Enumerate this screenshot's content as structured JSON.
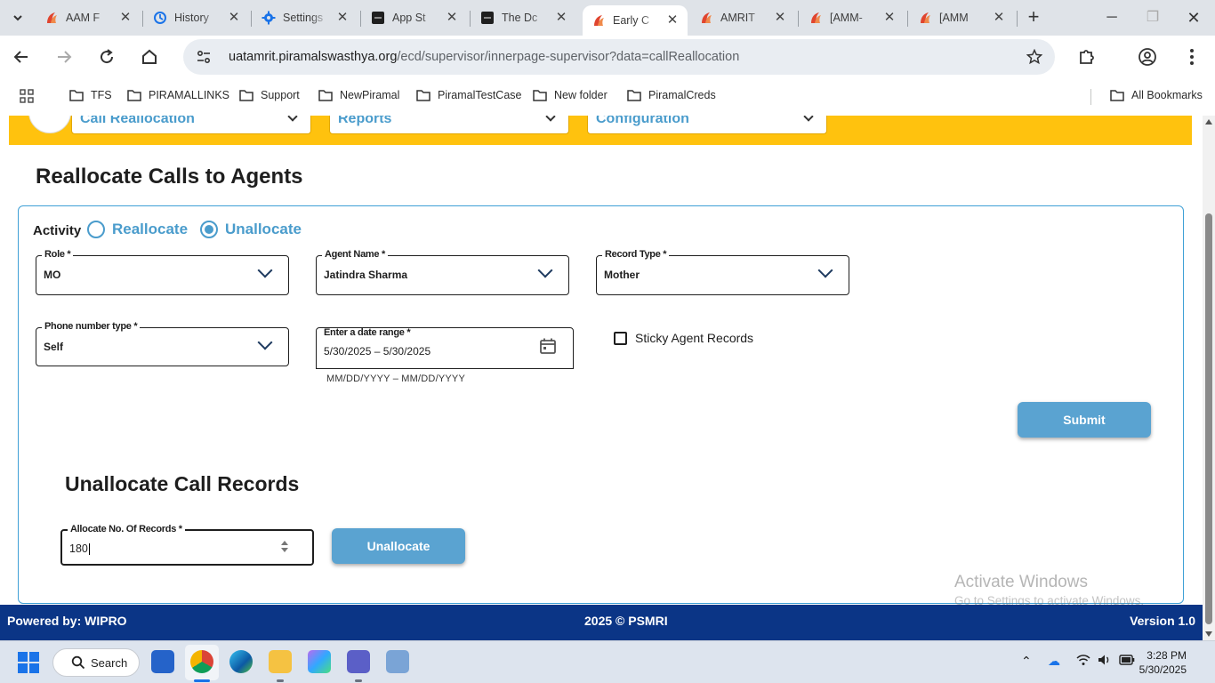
{
  "browser": {
    "tabs": [
      {
        "label": "AAM F",
        "icon": "amrit-logo-icon"
      },
      {
        "label": "History",
        "icon": "history-icon"
      },
      {
        "label": "Settings",
        "icon": "gear-icon"
      },
      {
        "label": "App St",
        "icon": "appstore-icon"
      },
      {
        "label": "The Dc",
        "icon": "appstore-icon"
      },
      {
        "label": "Early C",
        "icon": "amrit-logo-icon",
        "active": true
      },
      {
        "label": "AMRIT",
        "icon": "amrit-logo-icon"
      },
      {
        "label": "[AMM-",
        "icon": "amrit-logo-icon"
      },
      {
        "label": "[AMM",
        "icon": "amrit-logo-icon"
      }
    ],
    "url_host": "uatamrit.piramalswasthya.org",
    "url_path": "/ecd/supervisor/innerpage-supervisor?data=callReallocation",
    "bookmarks": [
      "TFS",
      "PIRAMALLINKS",
      "Support",
      "NewPiramal",
      "PiramalTestCase",
      "New folder",
      "PiramalCreds"
    ],
    "all_bookmarks": "All Bookmarks"
  },
  "app": {
    "top_menus": [
      "Call Reallocation",
      "Reports",
      "Configuration"
    ],
    "page_title": "Reallocate Calls to Agents",
    "activity": {
      "label": "Activity",
      "options": [
        "Reallocate",
        "Unallocate"
      ],
      "selected": "Unallocate"
    },
    "fields": {
      "role": {
        "label": "Role",
        "value": "MO"
      },
      "agent_name": {
        "label": "Agent Name",
        "value": "Jatindra Sharma"
      },
      "record_type": {
        "label": "Record Type",
        "value": "Mother"
      },
      "phone_type": {
        "label": "Phone number type",
        "value": "Self"
      },
      "date_range": {
        "label": "Enter a date range",
        "value": "5/30/2025 – 5/30/2025",
        "hint": "MM/DD/YYYY – MM/DD/YYYY"
      }
    },
    "sticky_label": "Sticky Agent Records",
    "submit_label": "Submit",
    "unallocate_section": {
      "title": "Unallocate Call Records",
      "records_label": "Allocate No. Of Records",
      "records_value": "180",
      "button_label": "Unallocate"
    },
    "footer": {
      "left": "Powered by: WIPRO",
      "center": "2025 © PSMRI",
      "right": "Version 1.0"
    },
    "watermark": {
      "line1": "Activate Windows",
      "line2": "Go to Settings to activate Windows."
    },
    "colors": {
      "accent": "#4a9ccc",
      "header": "#ffc20e",
      "footer": "#0b3586"
    }
  },
  "taskbar": {
    "search_label": "Search",
    "time": "3:28 PM",
    "date": "5/30/2025"
  }
}
